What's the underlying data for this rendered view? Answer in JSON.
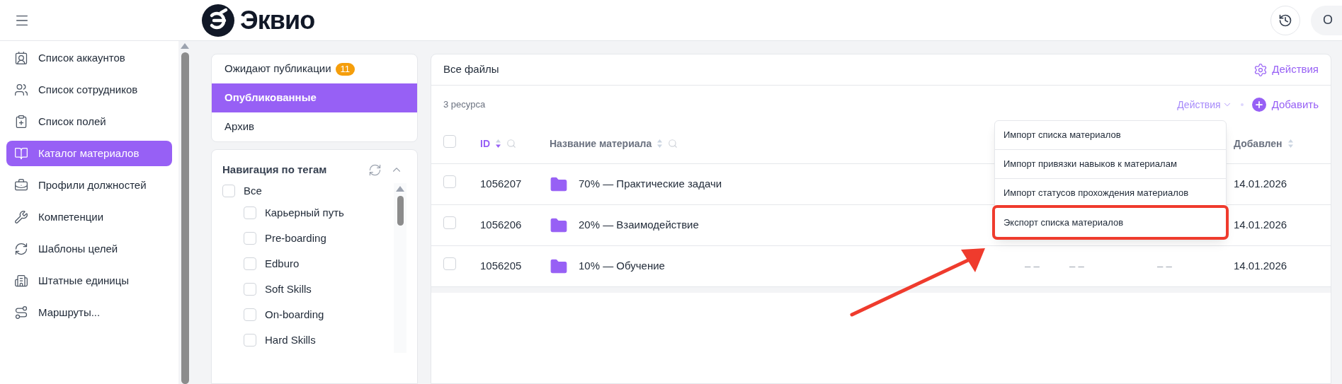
{
  "header": {
    "logo_text": "Эквио",
    "avatar": "О"
  },
  "sidebar": {
    "items": [
      {
        "label": "Список аккаунтов",
        "selected": false
      },
      {
        "label": "Список сотрудников",
        "selected": false
      },
      {
        "label": "Список полей",
        "selected": false
      },
      {
        "label": "Каталог материалов",
        "selected": true
      },
      {
        "label": "Профили должностей",
        "selected": false
      },
      {
        "label": "Компетенции",
        "selected": false
      },
      {
        "label": "Шаблоны целей",
        "selected": false
      },
      {
        "label": "Штатные единицы",
        "selected": false
      },
      {
        "label": "Маршруты...",
        "selected": false
      }
    ]
  },
  "tabs": [
    {
      "label": "Ожидают публикации",
      "badge": "11",
      "selected": false
    },
    {
      "label": "Опубликованные",
      "selected": true
    },
    {
      "label": "Архив",
      "selected": false
    }
  ],
  "tag_nav": {
    "title": "Навигация по тегам",
    "items": [
      {
        "label": "Все",
        "checked": false,
        "children": [
          {
            "label": "Карьерный путь",
            "checked": false
          },
          {
            "label": "Pre-boarding",
            "checked": false
          },
          {
            "label": "Edburo",
            "checked": false
          },
          {
            "label": "Soft Skills",
            "checked": false
          },
          {
            "label": "On-boarding",
            "checked": false
          },
          {
            "label": "Hard Skills",
            "checked": false
          }
        ]
      }
    ]
  },
  "files": {
    "title": "Все файлы",
    "select_all_checked": false,
    "actions_link": "Действия",
    "count": "3 ресурса",
    "actions_dropdown": "Действия",
    "add_button": "Добавить",
    "columns": [
      {
        "label": "ID",
        "sorted": true,
        "searchable": true
      },
      {
        "label": "Название материала",
        "sorted": false,
        "searchable": true
      },
      {
        "label": "Добавлен",
        "sorted": false,
        "searchable": false
      }
    ],
    "rows": [
      {
        "id": "1056207",
        "name": "70% — Практические задачи",
        "cells": [],
        "date": "14.01.2026",
        "checked": false
      },
      {
        "id": "1056206",
        "name": "20% — Взаимодействие",
        "cells": [],
        "date": "14.01.2026",
        "checked": false
      },
      {
        "id": "1056205",
        "name": "10% — Обучение",
        "cells": [
          "– –",
          "– –",
          "– –"
        ],
        "date": "14.01.2026",
        "checked": false
      }
    ],
    "menu": [
      {
        "label": "Импорт списка материалов",
        "highlighted": false
      },
      {
        "label": "Импорт привязки навыков к материалам",
        "highlighted": false
      },
      {
        "label": "Импорт статусов прохождения материалов",
        "highlighted": false
      },
      {
        "label": "Экспорт списка материалов",
        "highlighted": true
      }
    ]
  }
}
